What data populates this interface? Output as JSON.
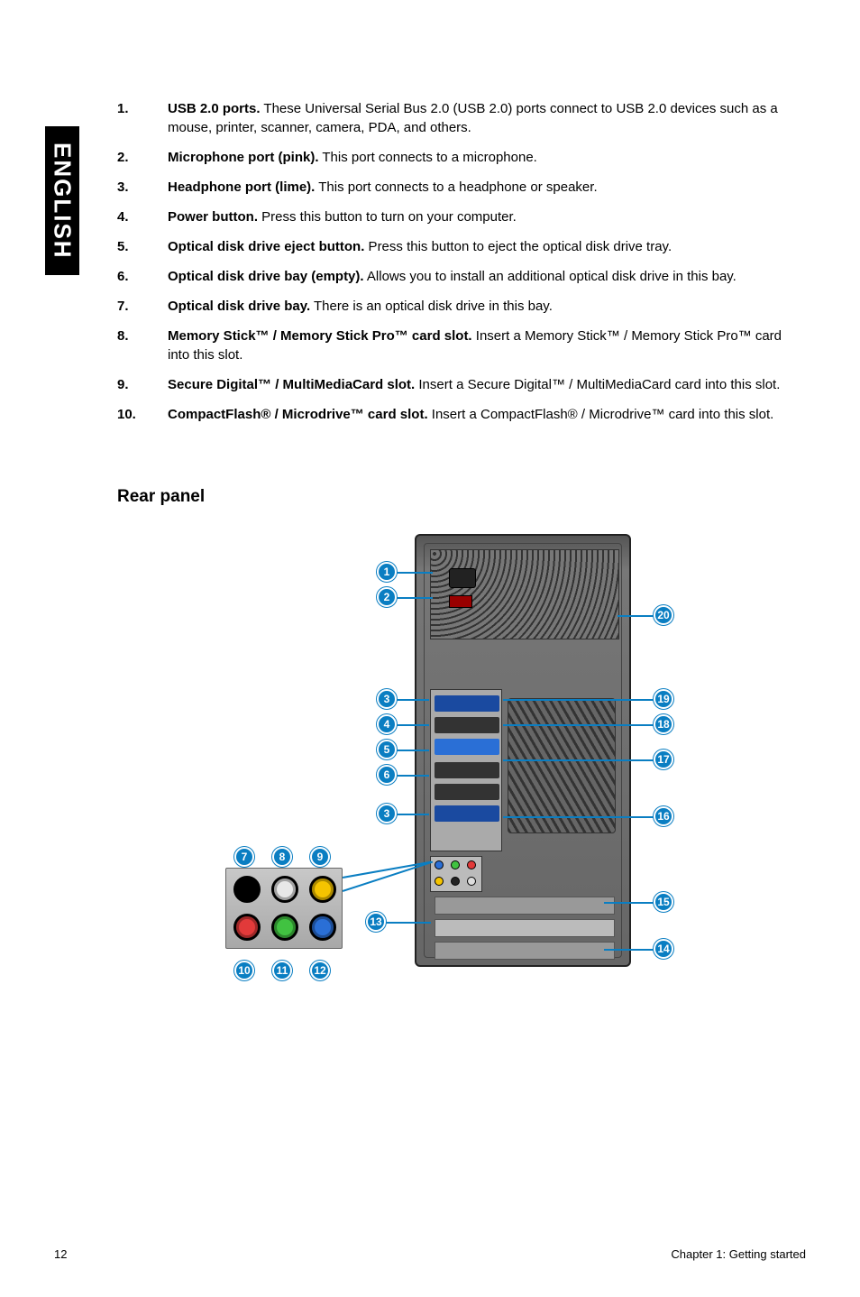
{
  "sideTab": "ENGLISH",
  "items": [
    {
      "num": "1.",
      "title": "USB 2.0 ports.",
      "desc": " These Universal Serial Bus 2.0 (USB 2.0) ports connect to USB 2.0 devices such as a mouse, printer, scanner, camera, PDA, and others."
    },
    {
      "num": "2.",
      "title": "Microphone port (pink).",
      "desc": " This port connects to a microphone."
    },
    {
      "num": "3.",
      "title": "Headphone port (lime).",
      "desc": " This port connects to a headphone or speaker."
    },
    {
      "num": "4.",
      "title": "Power button.",
      "desc": " Press this button to turn on your computer."
    },
    {
      "num": "5.",
      "title": "Optical disk drive eject button.",
      "desc": " Press this button to eject the optical disk drive tray."
    },
    {
      "num": "6.",
      "title": "Optical disk drive bay (empty).",
      "desc": " Allows you to install an additional optical disk drive in this bay."
    },
    {
      "num": "7.",
      "title": "Optical disk drive bay.",
      "desc": " There is an optical disk drive in this bay."
    },
    {
      "num": "8.",
      "title": "Memory Stick™ / Memory Stick Pro™ card slot.",
      "desc": " Insert a Memory Stick™ / Memory Stick Pro™ card into this slot."
    },
    {
      "num": "9.",
      "title": "Secure Digital™ / MultiMediaCard slot.",
      "desc": " Insert a Secure Digital™ / MultiMediaCard card into this slot."
    },
    {
      "num": "10.",
      "title": "CompactFlash® / Microdrive™ card slot.",
      "desc": " Insert a CompactFlash® / Microdrive™ card into this slot."
    }
  ],
  "sectionHeading": "Rear panel",
  "callouts": {
    "c1": "1",
    "c2": "2",
    "c3a": "3",
    "c3b": "3",
    "c4": "4",
    "c5": "5",
    "c6": "6",
    "c7": "7",
    "c8": "8",
    "c9": "9",
    "c10": "10",
    "c11": "11",
    "c12": "12",
    "c13": "13",
    "c14": "14",
    "c15": "15",
    "c16": "16",
    "c17": "17",
    "c18": "18",
    "c19": "19",
    "c20": "20"
  },
  "jackColors": {
    "topLeft": "#000000",
    "topMid": "#e8e8e8",
    "topRight": "#f5c400",
    "botLeft": "#e23a3a",
    "botMid": "#41c241",
    "botRight": "#2a6fd6"
  },
  "footer": {
    "page": "12",
    "chapter": "Chapter 1: Getting started"
  }
}
